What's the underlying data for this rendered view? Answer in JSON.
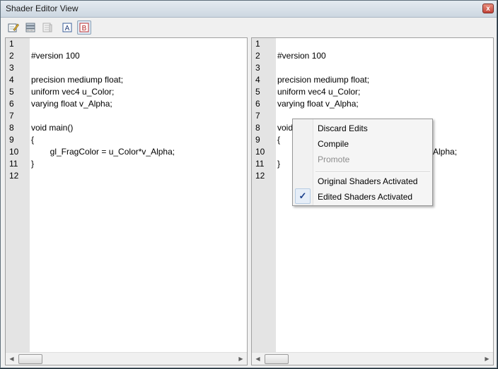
{
  "window": {
    "title": "Shader Editor View",
    "close_label": "x"
  },
  "toolbar": {
    "buttons": [
      {
        "name": "edit-icon"
      },
      {
        "name": "shader-list-icon"
      },
      {
        "name": "shader-list-disabled-icon"
      },
      {
        "name": "view-a-icon",
        "label": "A"
      },
      {
        "name": "view-b-icon",
        "label": "B"
      }
    ]
  },
  "left_editor": {
    "line_numbers": [
      "1",
      "2",
      "3",
      "4",
      "5",
      "6",
      "7",
      "8",
      "9",
      "10",
      "11",
      "12"
    ],
    "lines": [
      "",
      "#version 100",
      "",
      "precision mediump float;",
      "uniform vec4 u_Color;",
      "varying float v_Alpha;",
      "",
      "void main()",
      "{",
      "        gl_FragColor = u_Color*v_Alpha;",
      "}",
      ""
    ]
  },
  "right_editor": {
    "line_numbers": [
      "1",
      "2",
      "3",
      "4",
      "5",
      "6",
      "7",
      "8",
      "9",
      "10",
      "11",
      "12"
    ],
    "lines": [
      "",
      "#version 100",
      "",
      "precision mediump float;",
      "uniform vec4 u_Color;",
      "varying float v_Alpha;",
      "",
      "void",
      "{",
      "",
      "}",
      ""
    ],
    "line10_tail": "Alpha;"
  },
  "scroll": {
    "left_arrow": "◀",
    "right_arrow": "▶"
  },
  "context_menu": {
    "items": [
      {
        "label": "Discard Edits",
        "enabled": true
      },
      {
        "label": "Compile",
        "enabled": true
      },
      {
        "label": "Promote",
        "enabled": false
      },
      {
        "label": "Original Shaders Activated",
        "enabled": true
      },
      {
        "label": "Edited Shaders Activated",
        "enabled": true,
        "checked": true
      }
    ],
    "check_glyph": "✓"
  },
  "colors": {
    "gutter": "#e4e4e4",
    "menu_check": "#1a3f8c",
    "disabled_text": "#8d8d8d"
  }
}
